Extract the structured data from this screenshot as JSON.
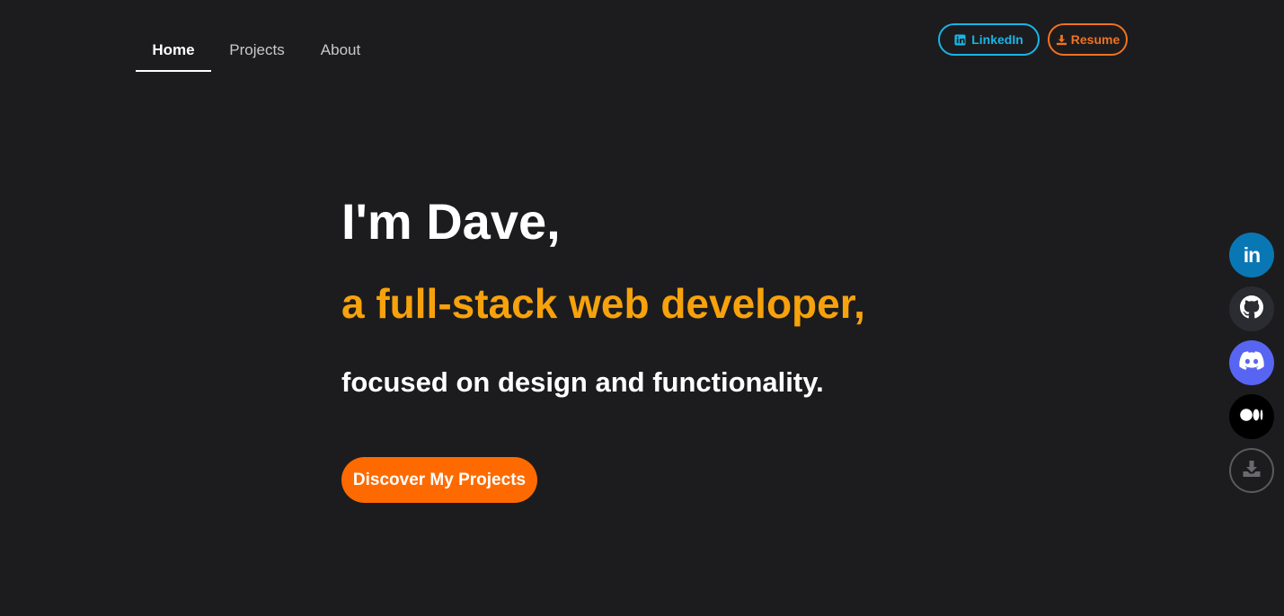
{
  "nav": {
    "items": [
      {
        "label": "Home",
        "active": true
      },
      {
        "label": "Projects",
        "active": false
      },
      {
        "label": "About",
        "active": false
      }
    ]
  },
  "header": {
    "linkedin_label": "LinkedIn",
    "resume_label": "Resume"
  },
  "hero": {
    "name": "I'm Dave,",
    "role": "a full-stack web developer,",
    "focus": "focused on design and functionality.",
    "cta_label": "Discover My Projects"
  },
  "social": {
    "linkedin_glyph": "in",
    "items": [
      "linkedin-icon",
      "github-icon",
      "discord-icon",
      "medium-icon",
      "download-icon"
    ]
  },
  "colors": {
    "background": "#1c1c1e",
    "linkedin_accent": "#1ab4e6",
    "resume_accent": "#f0731e",
    "role_text": "#f7a20c",
    "cta_background": "#ff6a00",
    "linkedin_brand": "#0a77b5",
    "discord_brand": "#5865f2"
  }
}
